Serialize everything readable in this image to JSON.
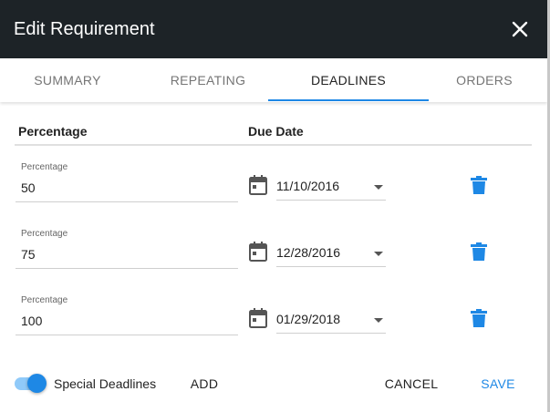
{
  "dialog": {
    "title": "Edit Requirement"
  },
  "tabs": [
    {
      "label": "SUMMARY",
      "active": false
    },
    {
      "label": "REPEATING",
      "active": false
    },
    {
      "label": "DEADLINES",
      "active": true
    },
    {
      "label": "ORDERS",
      "active": false
    }
  ],
  "table": {
    "headers": {
      "percentage": "Percentage",
      "due_date": "Due Date"
    },
    "rows": [
      {
        "percentage_label": "Percentage",
        "percentage": "50",
        "due_date": "11/10/2016"
      },
      {
        "percentage_label": "Percentage",
        "percentage": "75",
        "due_date": "12/28/2016"
      },
      {
        "percentage_label": "Percentage",
        "percentage": "100",
        "due_date": "01/29/2018"
      }
    ]
  },
  "footer": {
    "toggle_label": "Special Deadlines",
    "toggle_on": true,
    "add_label": "ADD",
    "cancel_label": "CANCEL",
    "save_label": "SAVE"
  },
  "icons": {
    "close": "close-icon",
    "calendar": "calendar-icon",
    "delete": "trash-icon"
  },
  "colors": {
    "header_bg": "#1d2327",
    "accent": "#1e88e5",
    "toggle_track": "#90caf9"
  }
}
